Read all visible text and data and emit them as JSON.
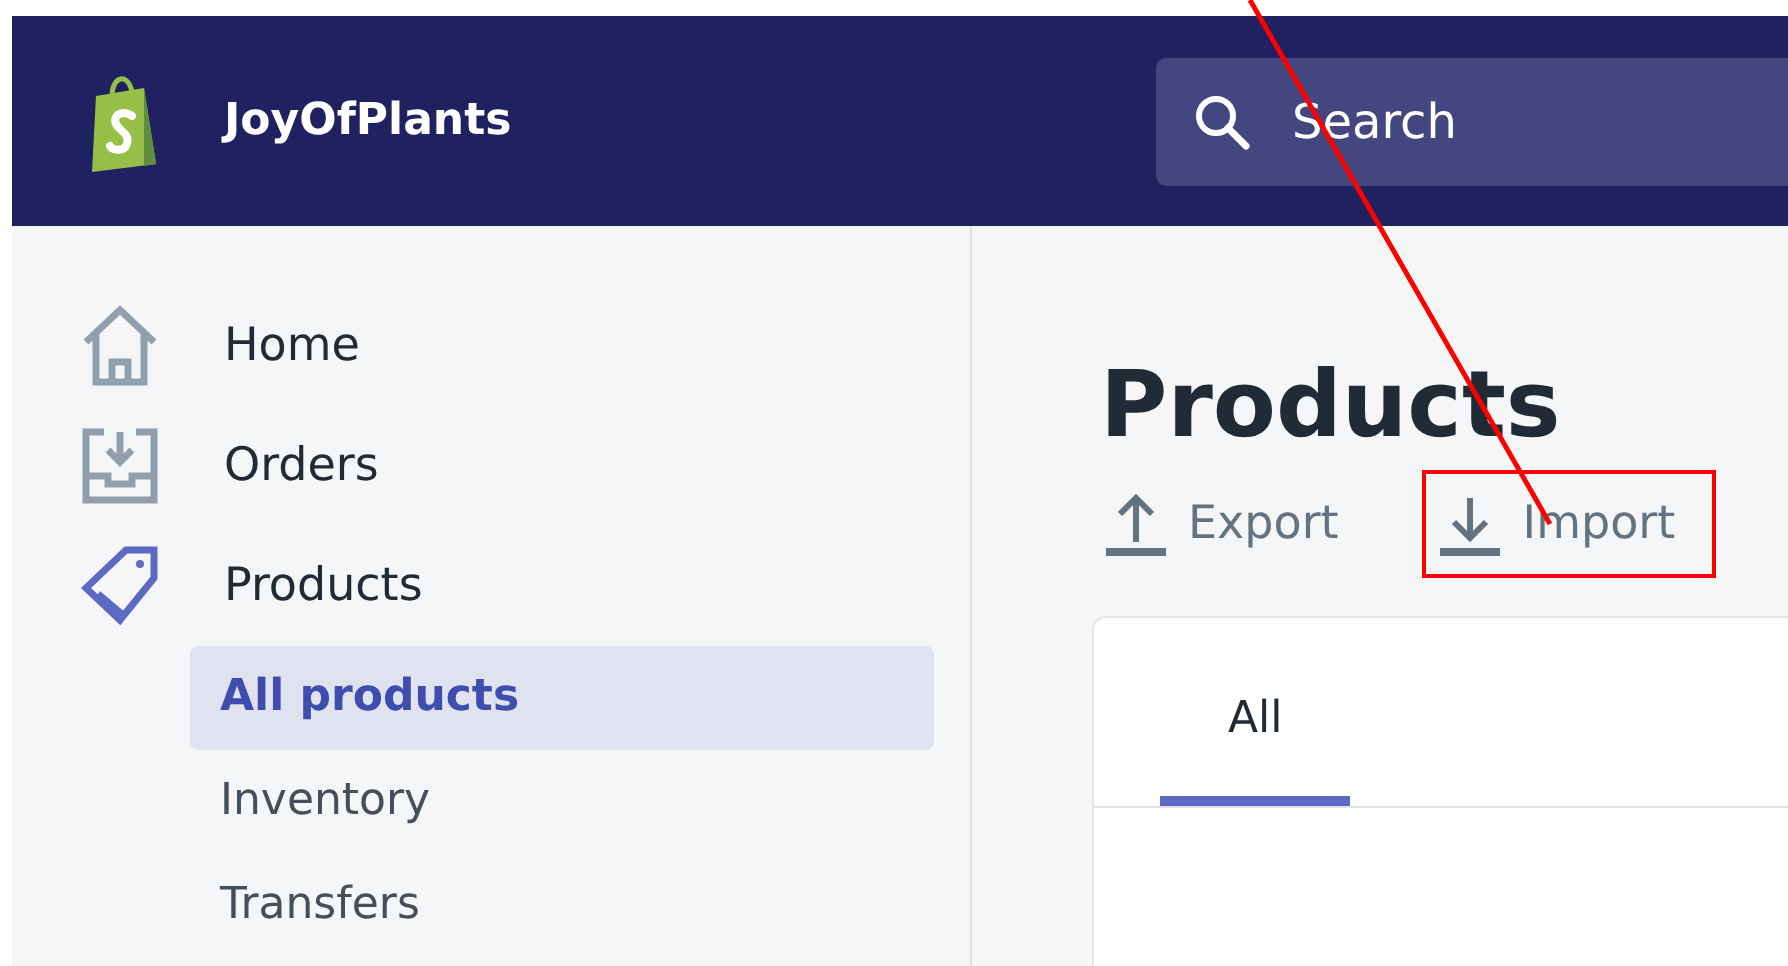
{
  "store": {
    "name": "JoyOfPlants"
  },
  "search": {
    "placeholder": "Search"
  },
  "sidebar": {
    "items": [
      {
        "label": "Home",
        "kind": "home",
        "selected": false
      },
      {
        "label": "Orders",
        "kind": "orders",
        "selected": false
      },
      {
        "label": "Products",
        "kind": "products",
        "selected": true,
        "children": [
          {
            "label": "All products",
            "selected": true
          },
          {
            "label": "Inventory",
            "selected": false
          },
          {
            "label": "Transfers",
            "selected": false
          }
        ]
      }
    ]
  },
  "page": {
    "title": "Products",
    "actions": [
      {
        "label": "Export",
        "kind": "export",
        "highlighted": false
      },
      {
        "label": "Import",
        "kind": "import",
        "highlighted": true
      }
    ]
  },
  "tabs": [
    {
      "label": "All",
      "selected": true
    }
  ]
}
